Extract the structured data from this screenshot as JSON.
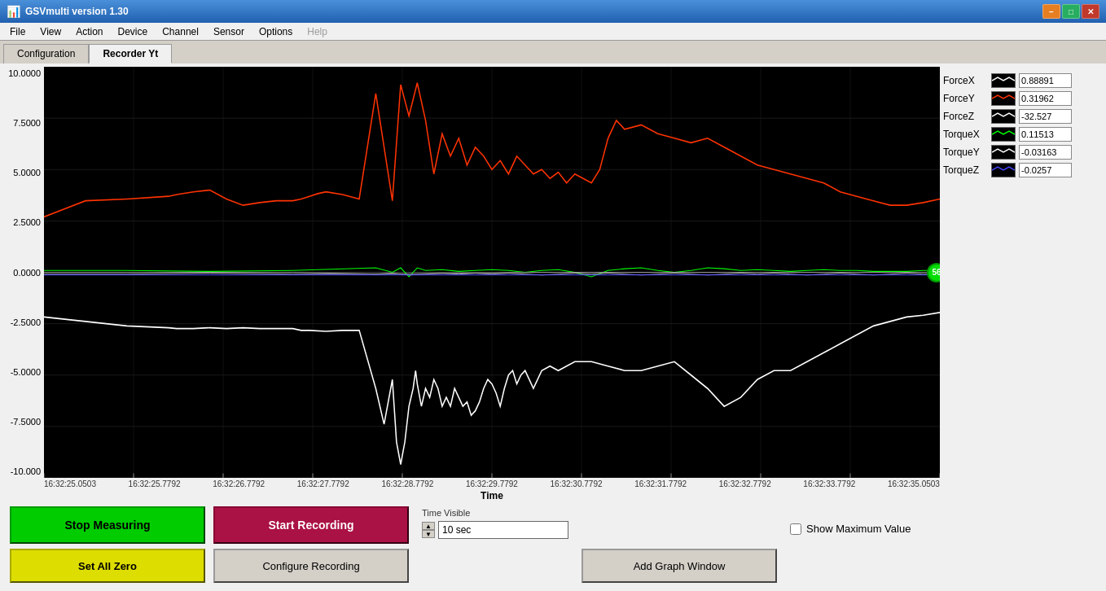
{
  "window": {
    "title": "GSVmulti version 1.30",
    "controls": {
      "minimize": "−",
      "maximize": "□",
      "close": "✕"
    }
  },
  "menu": {
    "items": [
      "File",
      "View",
      "Action",
      "Device",
      "Channel",
      "Sensor",
      "Options",
      "Help"
    ]
  },
  "tabs": [
    {
      "label": "Configuration",
      "active": false
    },
    {
      "label": "Recorder Yt",
      "active": true
    }
  ],
  "chart": {
    "y_labels": [
      "10.0000",
      "7.5000",
      "5.0000",
      "2.5000",
      "0.0000",
      "-2.5000",
      "-5.0000",
      "-7.5000",
      "-10.000"
    ],
    "x_labels": [
      "16:32:25.0503",
      "16:32:25.7792",
      "16:32:26.7792",
      "16:32:27.7792",
      "16:32:28.7792",
      "16:32:29.7792",
      "16:32:30.7792",
      "16:32:31.7792",
      "16:32:32.7792",
      "16:32:33.7792",
      "16:32:35.0503"
    ],
    "x_title": "Time"
  },
  "legend": {
    "items": [
      {
        "name": "ForceX",
        "color": "#ffffff",
        "value": "0.88891"
      },
      {
        "name": "ForceY",
        "color": "#ff3300",
        "value": "0.31962"
      },
      {
        "name": "ForceZ",
        "color": "#ffffff",
        "value": "-32.527"
      },
      {
        "name": "TorqueX",
        "color": "#00ff00",
        "value": "0.11513"
      },
      {
        "name": "TorqueY",
        "color": "#ffffff",
        "value": "-0.03163"
      },
      {
        "name": "TorqueZ",
        "color": "#3333ff",
        "value": "-0.0257"
      }
    ]
  },
  "buttons": {
    "stop_measuring": "Stop Measuring",
    "start_recording": "Start Recording",
    "set_all_zero": "Set All Zero",
    "configure_recording": "Configure Recording",
    "add_graph_window": "Add Graph Window"
  },
  "time_visible": {
    "label": "Time Visible",
    "value": "10 sec"
  },
  "show_maximum_value": {
    "label": "Show Maximum Value",
    "checked": false
  },
  "green_circle": {
    "label": "56"
  }
}
